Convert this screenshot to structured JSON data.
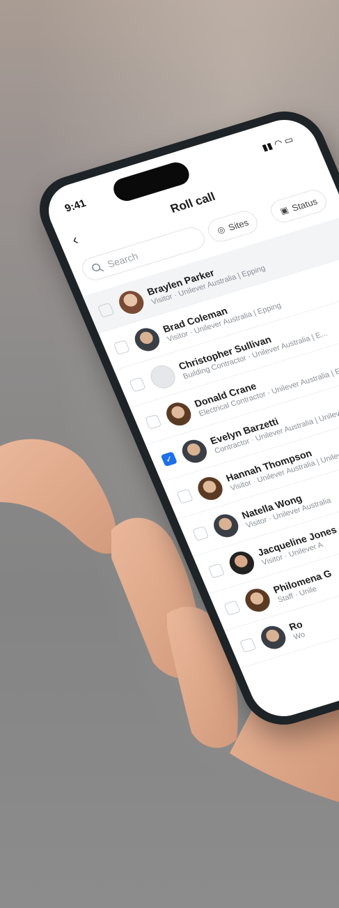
{
  "status_bar": {
    "time": "9:41",
    "icons": "signal wifi battery"
  },
  "nav": {
    "title": "Roll call",
    "back_icon": "chevron-left-icon"
  },
  "search": {
    "placeholder": "Search"
  },
  "chips": {
    "sites": "Sites",
    "status": "Status"
  },
  "people": [
    {
      "name": "Braylen Parker",
      "sub": "Visitor · Unilever Australia | Epping",
      "checked": false,
      "highlight": true
    },
    {
      "name": "Brad Coleman",
      "sub": "Visitor · Unilever Australia | Epping",
      "checked": false,
      "highlight": false
    },
    {
      "name": "Christopher Sullivan",
      "sub": "Building Contractor · Unilever Australia | E...",
      "checked": false,
      "highlight": false
    },
    {
      "name": "Donald Crane",
      "sub": "Electrical Contractor · Unilever Australia | Epping",
      "checked": false,
      "highlight": false
    },
    {
      "name": "Evelyn Barzetti",
      "sub": "Contractor · Unilever Australia | Unilever",
      "checked": true,
      "highlight": false
    },
    {
      "name": "Hannah Thompson",
      "sub": "Visitor · Unilever Australia | Unilever",
      "checked": false,
      "highlight": false
    },
    {
      "name": "Natella Wong",
      "sub": "Visitor · Unilever Australia",
      "checked": false,
      "highlight": false
    },
    {
      "name": "Jacqueline Jones",
      "sub": "Visitor · Unilever A",
      "checked": false,
      "highlight": false
    },
    {
      "name": "Philomena G",
      "sub": "Staff · Unile",
      "checked": false,
      "highlight": false
    },
    {
      "name": "Ro",
      "sub": "Wo",
      "checked": false,
      "highlight": false
    }
  ],
  "colors": {
    "accent": "#1e6fe8",
    "fab": "#1e7cf2",
    "phone_frame": "#1d2326"
  }
}
